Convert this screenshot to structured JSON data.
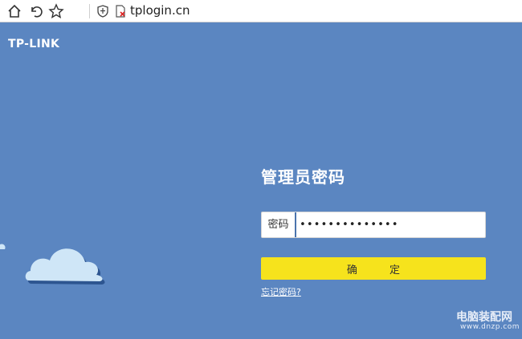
{
  "browser": {
    "url": "tplogin.cn",
    "icons": [
      "home-icon",
      "back-icon",
      "star-icon",
      "shield-icon",
      "insecure-page-icon"
    ]
  },
  "page": {
    "logo": "TP-LINK",
    "title": "管理员密码",
    "password_label": "密码",
    "password_value": "••••••••••••••",
    "confirm_label": "确 定",
    "forgot_link": "忘记密码?",
    "watermark_cn": "电脑装配网",
    "watermark_url": "www.dnzp.com"
  },
  "colors": {
    "background": "#5b86c1",
    "button": "#f6e31c",
    "cloud": "#cfe6f7"
  }
}
